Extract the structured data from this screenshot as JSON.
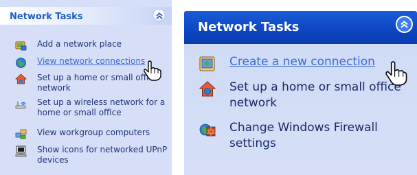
{
  "small_panel": {
    "title": "Network Tasks",
    "tasks": [
      {
        "label": "Add a network place",
        "icon": "network-place-icon"
      },
      {
        "label": "View network connections",
        "icon": "network-connections-icon",
        "hovered": true
      },
      {
        "label": "Set up a home or small office network",
        "icon": "home-network-icon"
      },
      {
        "label": "Set up a wireless network for a home or small office",
        "icon": "wireless-network-icon"
      },
      {
        "label": "View workgroup computers",
        "icon": "workgroup-computers-icon"
      },
      {
        "label": "Show icons for networked UPnP devices",
        "icon": "upnp-devices-icon"
      }
    ]
  },
  "large_panel": {
    "title": "Network Tasks",
    "tasks": [
      {
        "label": "Create a new connection",
        "icon": "new-connection-icon",
        "hovered": true
      },
      {
        "label": "Set up a home or small office network",
        "icon": "home-network-icon"
      },
      {
        "label": "Change Windows Firewall settings",
        "icon": "firewall-icon"
      }
    ]
  },
  "colors": {
    "panel_bg": "#d6dff7",
    "title_blue": "#215dc6",
    "link_blue": "#3c6ad8",
    "header_blue": "#0c46c1"
  }
}
